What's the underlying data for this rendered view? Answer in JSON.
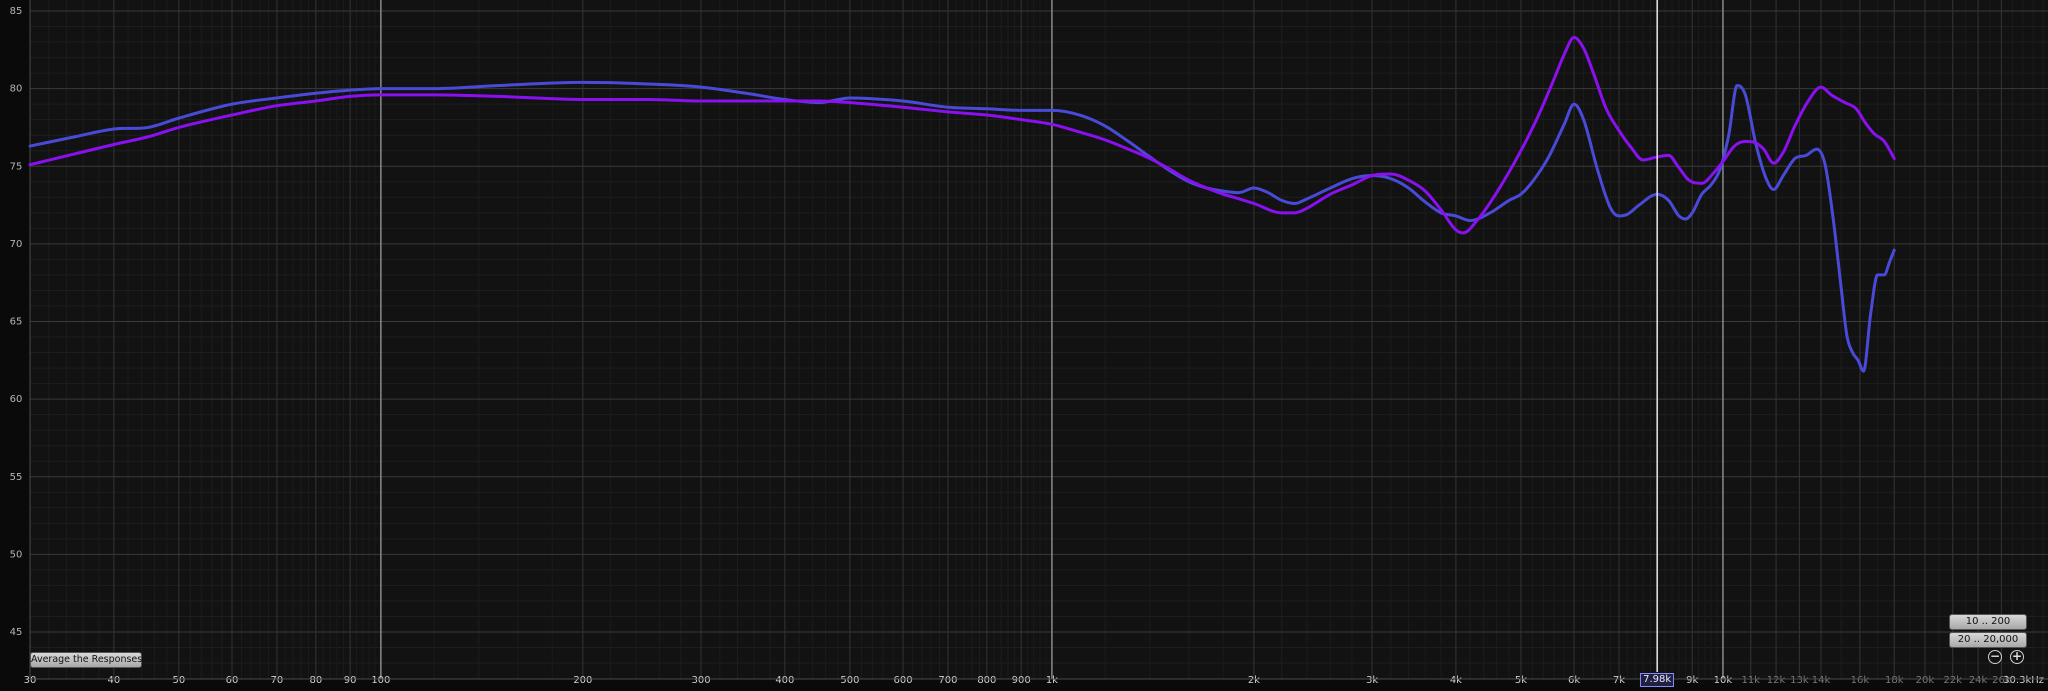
{
  "chart_data": {
    "type": "line",
    "x_scale": "log",
    "xlim_hz": [
      30,
      30300
    ],
    "ylim": [
      42,
      86
    ],
    "grid": true,
    "y_ticks": [
      85,
      80,
      75,
      70,
      65,
      60,
      55,
      50,
      45
    ],
    "x_ticks": [
      {
        "hz": 30,
        "label": "30"
      },
      {
        "hz": 40,
        "label": "40"
      },
      {
        "hz": 50,
        "label": "50"
      },
      {
        "hz": 60,
        "label": "60"
      },
      {
        "hz": 70,
        "label": "70"
      },
      {
        "hz": 80,
        "label": "80"
      },
      {
        "hz": 90,
        "label": "90"
      },
      {
        "hz": 100,
        "label": "100"
      },
      {
        "hz": 200,
        "label": "200"
      },
      {
        "hz": 300,
        "label": "300"
      },
      {
        "hz": 400,
        "label": "400"
      },
      {
        "hz": 500,
        "label": "500"
      },
      {
        "hz": 600,
        "label": "600"
      },
      {
        "hz": 700,
        "label": "700"
      },
      {
        "hz": 800,
        "label": "800"
      },
      {
        "hz": 900,
        "label": "900"
      },
      {
        "hz": 1000,
        "label": "1k"
      },
      {
        "hz": 2000,
        "label": "2k"
      },
      {
        "hz": 3000,
        "label": "3k"
      },
      {
        "hz": 4000,
        "label": "4k"
      },
      {
        "hz": 5000,
        "label": "5k"
      },
      {
        "hz": 6000,
        "label": "6k"
      },
      {
        "hz": 7000,
        "label": "7k"
      },
      {
        "hz": 9000,
        "label": "9k"
      },
      {
        "hz": 10000,
        "label": "10k"
      },
      {
        "hz": 11000,
        "label": "11k"
      },
      {
        "hz": 12000,
        "label": "12k"
      },
      {
        "hz": 13000,
        "label": "13k"
      },
      {
        "hz": 14000,
        "label": "14k"
      },
      {
        "hz": 16000,
        "label": "16k"
      },
      {
        "hz": 18000,
        "label": "18k"
      },
      {
        "hz": 20000,
        "label": "20k"
      },
      {
        "hz": 22000,
        "label": "22k"
      },
      {
        "hz": 24000,
        "label": "24k"
      },
      {
        "hz": 26000,
        "label": "26k"
      },
      {
        "hz": 30300,
        "label": "30.3kHz"
      }
    ],
    "cursor": {
      "hz": 7980,
      "label": "7.98k"
    },
    "series": [
      {
        "color": "#4a4ad8",
        "points": [
          [
            30,
            76.3
          ],
          [
            35,
            76.9
          ],
          [
            40,
            77.4
          ],
          [
            45,
            77.5
          ],
          [
            50,
            78.1
          ],
          [
            60,
            79.0
          ],
          [
            70,
            79.4
          ],
          [
            80,
            79.7
          ],
          [
            90,
            79.9
          ],
          [
            100,
            80.0
          ],
          [
            120,
            80.0
          ],
          [
            150,
            80.2
          ],
          [
            200,
            80.4
          ],
          [
            250,
            80.3
          ],
          [
            300,
            80.1
          ],
          [
            350,
            79.7
          ],
          [
            400,
            79.3
          ],
          [
            450,
            79.1
          ],
          [
            500,
            79.4
          ],
          [
            600,
            79.2
          ],
          [
            700,
            78.8
          ],
          [
            800,
            78.7
          ],
          [
            900,
            78.6
          ],
          [
            1000,
            78.6
          ],
          [
            1100,
            78.3
          ],
          [
            1200,
            77.6
          ],
          [
            1300,
            76.6
          ],
          [
            1400,
            75.6
          ],
          [
            1500,
            74.7
          ],
          [
            1600,
            74.0
          ],
          [
            1700,
            73.6
          ],
          [
            1800,
            73.4
          ],
          [
            1900,
            73.3
          ],
          [
            2000,
            73.6
          ],
          [
            2100,
            73.3
          ],
          [
            2200,
            72.8
          ],
          [
            2300,
            72.6
          ],
          [
            2400,
            72.9
          ],
          [
            2600,
            73.6
          ],
          [
            2800,
            74.2
          ],
          [
            3000,
            74.4
          ],
          [
            3200,
            74.2
          ],
          [
            3400,
            73.6
          ],
          [
            3600,
            72.7
          ],
          [
            3800,
            72.0
          ],
          [
            4000,
            71.8
          ],
          [
            4200,
            71.5
          ],
          [
            4500,
            72.0
          ],
          [
            4800,
            72.8
          ],
          [
            5000,
            73.2
          ],
          [
            5200,
            74.0
          ],
          [
            5500,
            75.6
          ],
          [
            5800,
            77.7
          ],
          [
            6000,
            79.0
          ],
          [
            6200,
            78.0
          ],
          [
            6500,
            74.8
          ],
          [
            6800,
            72.3
          ],
          [
            7000,
            71.8
          ],
          [
            7200,
            71.9
          ],
          [
            7500,
            72.5
          ],
          [
            7980,
            73.2
          ],
          [
            8300,
            72.8
          ],
          [
            8600,
            71.8
          ],
          [
            8800,
            71.6
          ],
          [
            9000,
            72.0
          ],
          [
            9300,
            73.2
          ],
          [
            9600,
            73.8
          ],
          [
            9900,
            74.8
          ],
          [
            10200,
            77.0
          ],
          [
            10500,
            80.2
          ],
          [
            10800,
            79.6
          ],
          [
            11200,
            76.4
          ],
          [
            11600,
            74.2
          ],
          [
            11900,
            73.5
          ],
          [
            12300,
            74.4
          ],
          [
            12800,
            75.5
          ],
          [
            13300,
            75.7
          ],
          [
            13800,
            76.1
          ],
          [
            14200,
            75.1
          ],
          [
            14600,
            71.6
          ],
          [
            15000,
            67.2
          ],
          [
            15300,
            64.1
          ],
          [
            15600,
            63.0
          ],
          [
            15900,
            62.5
          ],
          [
            16200,
            61.8
          ],
          [
            16600,
            65.5
          ],
          [
            17000,
            68.0
          ],
          [
            17400,
            68.0
          ],
          [
            17700,
            68.8
          ],
          [
            18000,
            69.6
          ]
        ]
      },
      {
        "color": "#8a10f0",
        "points": [
          [
            30,
            75.1
          ],
          [
            35,
            75.8
          ],
          [
            40,
            76.4
          ],
          [
            45,
            76.9
          ],
          [
            50,
            77.5
          ],
          [
            60,
            78.3
          ],
          [
            70,
            78.9
          ],
          [
            80,
            79.2
          ],
          [
            90,
            79.5
          ],
          [
            100,
            79.6
          ],
          [
            120,
            79.6
          ],
          [
            150,
            79.5
          ],
          [
            200,
            79.3
          ],
          [
            250,
            79.3
          ],
          [
            300,
            79.2
          ],
          [
            350,
            79.2
          ],
          [
            400,
            79.2
          ],
          [
            450,
            79.2
          ],
          [
            500,
            79.1
          ],
          [
            600,
            78.8
          ],
          [
            700,
            78.5
          ],
          [
            800,
            78.3
          ],
          [
            900,
            78.0
          ],
          [
            1000,
            77.7
          ],
          [
            1100,
            77.2
          ],
          [
            1200,
            76.7
          ],
          [
            1300,
            76.1
          ],
          [
            1400,
            75.5
          ],
          [
            1500,
            74.8
          ],
          [
            1600,
            74.1
          ],
          [
            1700,
            73.6
          ],
          [
            1800,
            73.2
          ],
          [
            1900,
            72.9
          ],
          [
            2000,
            72.6
          ],
          [
            2200,
            72.0
          ],
          [
            2300,
            72.0
          ],
          [
            2400,
            72.3
          ],
          [
            2600,
            73.2
          ],
          [
            2800,
            73.8
          ],
          [
            3000,
            74.4
          ],
          [
            3200,
            74.5
          ],
          [
            3400,
            74.1
          ],
          [
            3600,
            73.4
          ],
          [
            3800,
            72.2
          ],
          [
            4000,
            70.9
          ],
          [
            4100,
            70.7
          ],
          [
            4300,
            71.5
          ],
          [
            4600,
            73.3
          ],
          [
            5000,
            76.0
          ],
          [
            5300,
            78.2
          ],
          [
            5600,
            80.6
          ],
          [
            5800,
            82.2
          ],
          [
            6000,
            83.3
          ],
          [
            6200,
            82.6
          ],
          [
            6400,
            81.1
          ],
          [
            6700,
            78.7
          ],
          [
            7000,
            77.3
          ],
          [
            7300,
            76.2
          ],
          [
            7600,
            75.4
          ],
          [
            7980,
            75.6
          ],
          [
            8300,
            75.7
          ],
          [
            8600,
            74.9
          ],
          [
            8900,
            74.1
          ],
          [
            9300,
            73.9
          ],
          [
            9700,
            74.6
          ],
          [
            10000,
            75.3
          ],
          [
            10400,
            76.3
          ],
          [
            10800,
            76.6
          ],
          [
            11200,
            76.5
          ],
          [
            11500,
            76.1
          ],
          [
            11900,
            75.2
          ],
          [
            12300,
            75.9
          ],
          [
            12800,
            77.6
          ],
          [
            13400,
            79.2
          ],
          [
            14000,
            80.1
          ],
          [
            14500,
            79.6
          ],
          [
            15200,
            79.1
          ],
          [
            15800,
            78.7
          ],
          [
            16300,
            77.8
          ],
          [
            16800,
            77.1
          ],
          [
            17400,
            76.6
          ],
          [
            18000,
            75.5
          ]
        ]
      }
    ]
  },
  "controls": {
    "average_button": "Average the Responses",
    "range_button_1": "10 .. 200",
    "range_button_2": "20 .. 20,000",
    "zoom_out_icon": "zoom-out-icon",
    "zoom_in_icon": "zoom-in-icon"
  }
}
